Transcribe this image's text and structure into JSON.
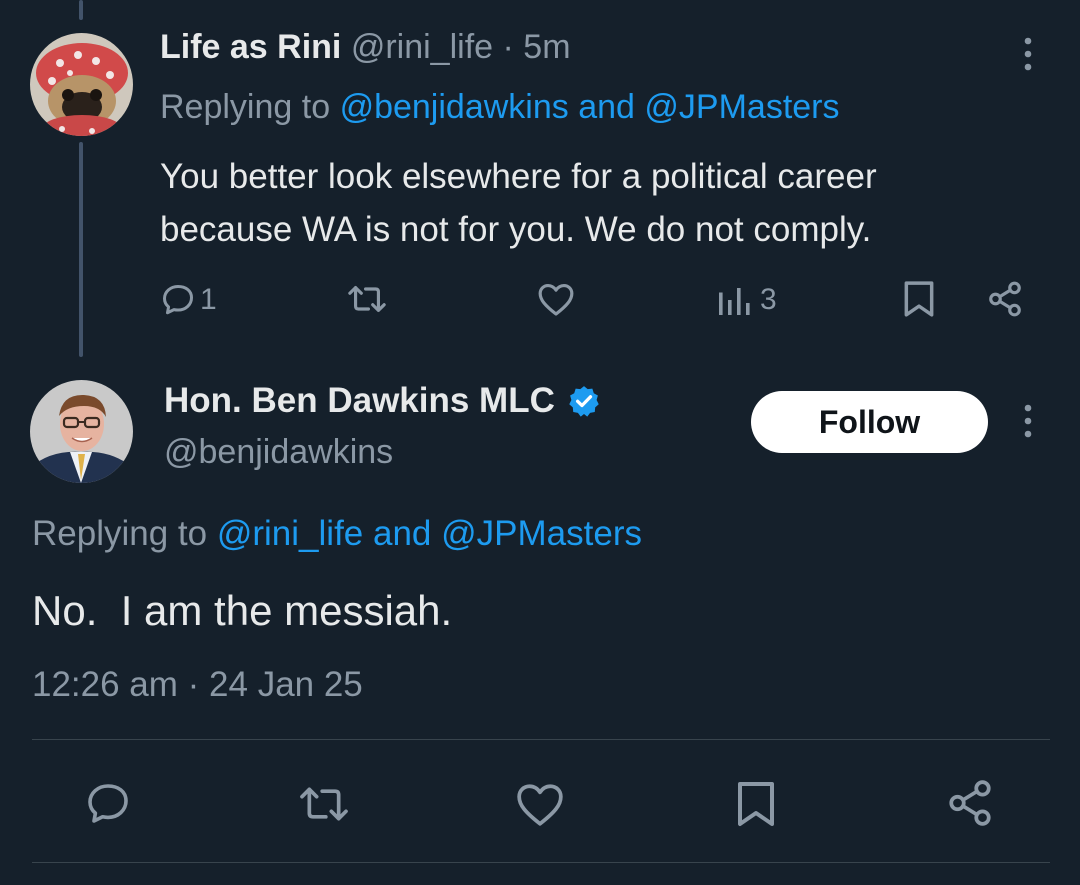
{
  "reply_tweet": {
    "display_name": "Life as Rini",
    "handle": "@rini_life",
    "separator": "·",
    "time_ago": "5m",
    "replying_prefix": "Replying to",
    "replying_handle_1": "@benjidawkins",
    "replying_and": "and",
    "replying_handle_2": "@JPMasters",
    "text_line_1": "You better look elsewhere for a political career",
    "text_line_2": "because WA is not for you. We do not comply.",
    "reply_count": "1",
    "view_count": "3",
    "avatar_icon": "pug-avatar-icon"
  },
  "main_tweet": {
    "display_name": "Hon. Ben Dawkins MLC",
    "handle": "@benjidawkins",
    "verified": true,
    "follow_label": "Follow",
    "replying_prefix": "Replying to",
    "replying_handle_1": "@rini_life",
    "replying_and": "and",
    "replying_handle_2": "@JPMasters",
    "text": "No.  I am the messiah.",
    "timestamp": "12:26 am · 24 Jan 25",
    "avatar_icon": "man-portrait-avatar-icon"
  },
  "colors": {
    "background": "#15202b",
    "text_primary": "#e7e9ea",
    "text_muted": "#8b98a5",
    "link": "#1d9bf0",
    "divider": "#38444d"
  }
}
